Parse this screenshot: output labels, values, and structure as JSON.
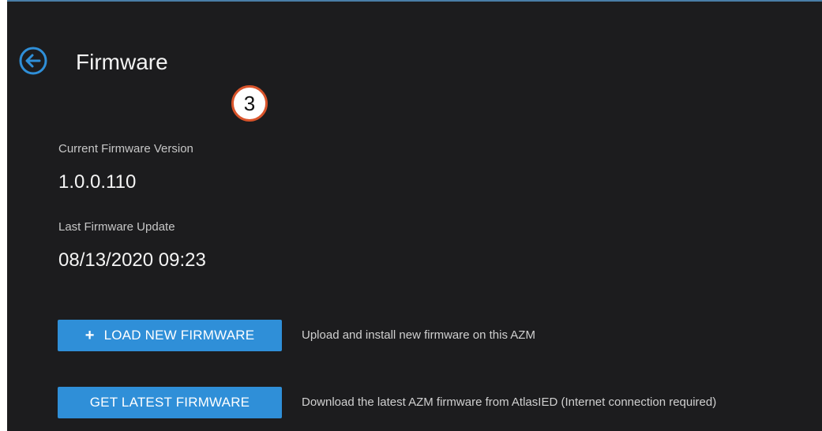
{
  "header": {
    "title": "Firmware",
    "back_icon": "arrow-left-circle-icon"
  },
  "annotation": {
    "step_number": "3"
  },
  "firmware": {
    "current_version_label": "Current Firmware Version",
    "current_version_value": "1.0.0.110",
    "last_update_label": "Last Firmware Update",
    "last_update_value": "08/13/2020 09:23"
  },
  "actions": {
    "load": {
      "icon": "plus-icon",
      "icon_glyph": "+",
      "label": "LOAD NEW FIRMWARE",
      "description": "Upload and install new firmware on this AZM"
    },
    "get_latest": {
      "label": "GET LATEST FIRMWARE",
      "description": "Download the latest AZM firmware from AtlasIED (Internet connection required)"
    }
  },
  "colors": {
    "background": "#1c1c1e",
    "accent": "#2f8fd8",
    "badge_border": "#d9542b"
  }
}
